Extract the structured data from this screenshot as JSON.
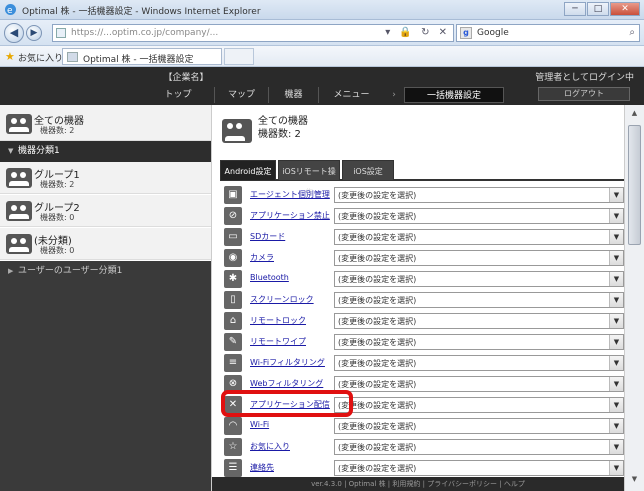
{
  "browser": {
    "title": "Optimal 株 - 一括機器設定 - Windows Internet Explorer",
    "url": "https://...optim.co.jp/company/...",
    "search_engine": "Google",
    "favorites_label": "お気に入り",
    "tab_title": "Optimal 株 - 一括機器設定",
    "window_buttons": [
      "─",
      "□",
      "✕"
    ]
  },
  "header": {
    "company": "【企業名】",
    "login_info": "管理者としてログイン中",
    "nav": {
      "top": "トップ",
      "map": "マップ",
      "device": "機器",
      "menu": "メニュー",
      "arrow": "›",
      "bulk": "一括機器設定"
    },
    "logout": "ログアウト"
  },
  "sidebar": {
    "all_devices": {
      "title": "全ての機器",
      "count": "機器数: 2"
    },
    "category": "機器分類1",
    "groups": [
      {
        "title": "グループ1",
        "count": "機器数: 2"
      },
      {
        "title": "グループ2",
        "count": "機器数: 0"
      },
      {
        "title": "(未分類)",
        "count": "機器数: 0"
      }
    ],
    "user_category": "ユーザーのユーザー分類1"
  },
  "main": {
    "title": "全ての機器",
    "count": "機器数: 2",
    "tabs": [
      "Android設定",
      "iOSリモート操作",
      "iOS設定"
    ],
    "settings": [
      {
        "label": "エージェント個別管理",
        "value": "(変更後の設定を選択)"
      },
      {
        "label": "アプリケーション禁止",
        "value": "(変更後の設定を選択)"
      },
      {
        "label": "SDカード",
        "value": "(変更後の設定を選択)"
      },
      {
        "label": "カメラ",
        "value": "(変更後の設定を選択)"
      },
      {
        "label": "Bluetooth",
        "value": "(変更後の設定を選択)"
      },
      {
        "label": "スクリーンロック",
        "value": "(変更後の設定を選択)"
      },
      {
        "label": "リモートロック",
        "value": "(変更後の設定を選択)"
      },
      {
        "label": "リモートワイプ",
        "value": "(変更後の設定を選択)"
      },
      {
        "label": "Wi-Fiフィルタリング",
        "value": "(変更後の設定を選択)"
      },
      {
        "label": "Webフィルタリング",
        "value": "(変更後の設定を選択)"
      },
      {
        "label": "アプリケーション配信",
        "value": "(変更後の設定を選択)"
      },
      {
        "label": "Wi-Fi",
        "value": "(変更後の設定を選択)"
      },
      {
        "label": "お気に入り",
        "value": "(変更後の設定を選択)"
      },
      {
        "label": "連絡先",
        "value": "(変更後の設定を選択)"
      }
    ]
  },
  "footer": "ver.4.3.0 | Optimal 株 | 利用規約 | プライバシーポリシー | ヘルプ",
  "colors": {
    "highlight": "#e01010",
    "header_bg": "#2a2a2a",
    "link": "#1a1aa6"
  }
}
